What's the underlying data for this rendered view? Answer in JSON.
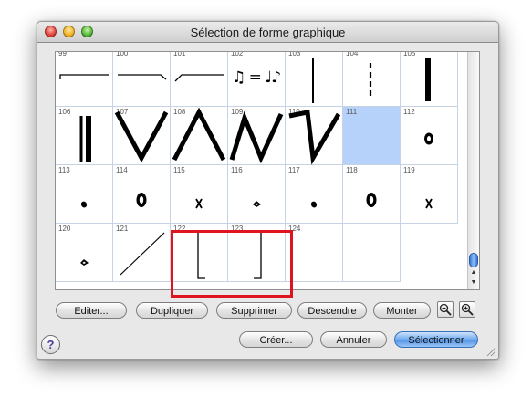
{
  "window": {
    "title": "Sélection de forme graphique"
  },
  "grid": {
    "cells": [
      {
        "num": "99",
        "shape": "line-hook-left"
      },
      {
        "num": "100",
        "shape": "line-hook-right"
      },
      {
        "num": "101",
        "shape": "line-slant-up"
      },
      {
        "num": "102",
        "shape": "note-swing"
      },
      {
        "num": "103",
        "shape": "vertical-line"
      },
      {
        "num": "104",
        "shape": "dashed-vertical-line"
      },
      {
        "num": "105",
        "shape": "thick-vertical-line"
      },
      {
        "num": "106",
        "shape": "double-bar"
      },
      {
        "num": "107",
        "shape": "v-shape"
      },
      {
        "num": "108",
        "shape": "inverted-v-shape"
      },
      {
        "num": "109",
        "shape": "n-zigzag"
      },
      {
        "num": "110",
        "shape": "z-zigzag"
      },
      {
        "num": "111",
        "shape": "empty-selected"
      },
      {
        "num": "112",
        "shape": "breath-dot"
      },
      {
        "num": "113",
        "shape": "dot"
      },
      {
        "num": "114",
        "shape": "zero-head"
      },
      {
        "num": "115",
        "shape": "x-head"
      },
      {
        "num": "116",
        "shape": "diamond-head"
      },
      {
        "num": "117",
        "shape": "dot"
      },
      {
        "num": "118",
        "shape": "zero-head"
      },
      {
        "num": "119",
        "shape": "x-head"
      },
      {
        "num": "120",
        "shape": "diamond-head"
      },
      {
        "num": "121",
        "shape": "diagonal-line"
      },
      {
        "num": "122",
        "shape": "left-bracket"
      },
      {
        "num": "123",
        "shape": "right-bracket"
      },
      {
        "num": "124",
        "shape": "empty"
      },
      {
        "num": "",
        "shape": "empty"
      }
    ],
    "selected": "111",
    "note_glyph": "♫ = ♩♪"
  },
  "buttons": {
    "edit": "Editer...",
    "duplicate": "Dupliquer",
    "delete": "Supprimer",
    "down": "Descendre",
    "up": "Monter",
    "create": "Créer...",
    "cancel": "Annuler",
    "select": "Sélectionner"
  },
  "help_symbol": "?",
  "accent": "#4f90e4",
  "selection_color": "#b6d2fb",
  "highlight_color": "#e0141e"
}
